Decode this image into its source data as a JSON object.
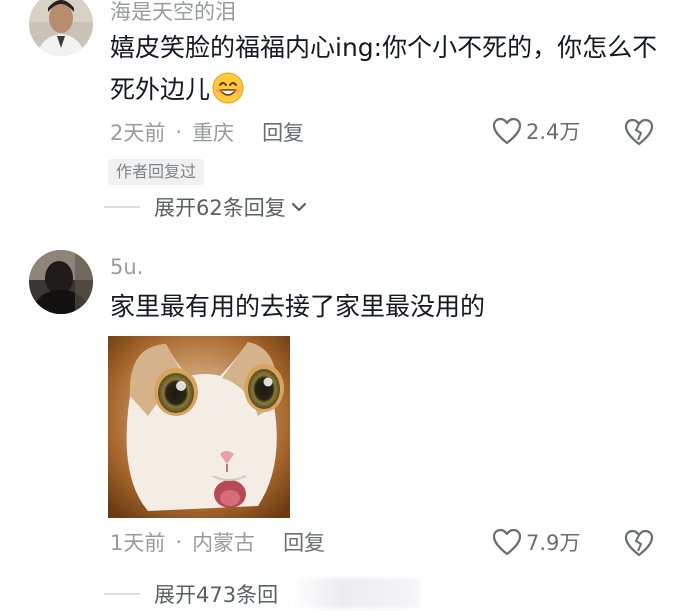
{
  "comments": [
    {
      "username": "海是天空的泪",
      "text": "嬉皮笑脸的福福内心ing:你个小不死的，你怎么不死外边儿",
      "emoji": "smiling-face-emoji",
      "time": "2天前",
      "location": "重庆",
      "reply_label": "回复",
      "likes": "2.4万",
      "author_badge": "作者回复过",
      "expand_label": "展开62条回复"
    },
    {
      "username": "5u.",
      "text": "家里最有用的去接了家里最没用的",
      "image": "surprised-cat-image",
      "time": "1天前",
      "location": "内蒙古",
      "reply_label": "回复",
      "likes": "7.9万",
      "expand_label": "展开473条回"
    }
  ],
  "colors": {
    "secondary_text": "#9a9ba0",
    "primary_text": "#161823",
    "badge_bg": "#f1f1f2"
  }
}
